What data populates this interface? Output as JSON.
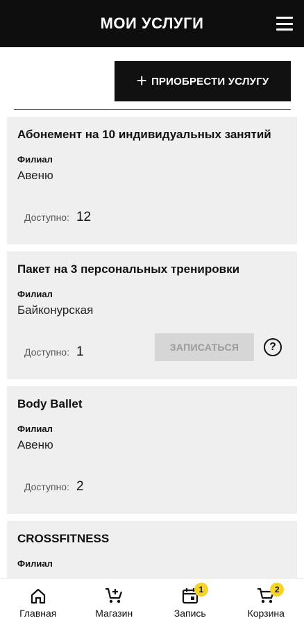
{
  "header": {
    "title": "МОИ УСЛУГИ",
    "menu_icon": "hamburger-menu-icon"
  },
  "actions": {
    "buy_service": "ПРИОБРЕСТИ УСЛУГУ"
  },
  "cards": [
    {
      "title": "Абонемент на 10 индивидуальных занятий",
      "branch_label": "Филиал",
      "branch": "Авеню",
      "available_label": "Доступно:",
      "available": "12"
    },
    {
      "title": "Пакет на 3 персональных тренировки",
      "branch_label": "Филиал",
      "branch": "Байконурская",
      "available_label": "Доступно:",
      "available": "1",
      "book_label": "ЗАПИСАТЬСЯ",
      "help_symbol": "?"
    },
    {
      "title": "Body Ballet",
      "branch_label": "Филиал",
      "branch": "Авеню",
      "available_label": "Доступно:",
      "available": "2"
    },
    {
      "title": "CROSSFITNESS",
      "branch_label": "Филиал"
    }
  ],
  "bottom_nav": [
    {
      "label": "Главная",
      "icon": "home-icon"
    },
    {
      "label": "Магазин",
      "icon": "cart-add-icon"
    },
    {
      "label": "Запись",
      "icon": "calendar-icon",
      "badge": "1"
    },
    {
      "label": "Корзина",
      "icon": "cart-icon",
      "badge": "2"
    }
  ],
  "colors": {
    "header_bg": "#0e0e0e",
    "card_bg": "#efefef",
    "badge": "#f5d327",
    "disabled_btn": "#d6d6d6"
  }
}
